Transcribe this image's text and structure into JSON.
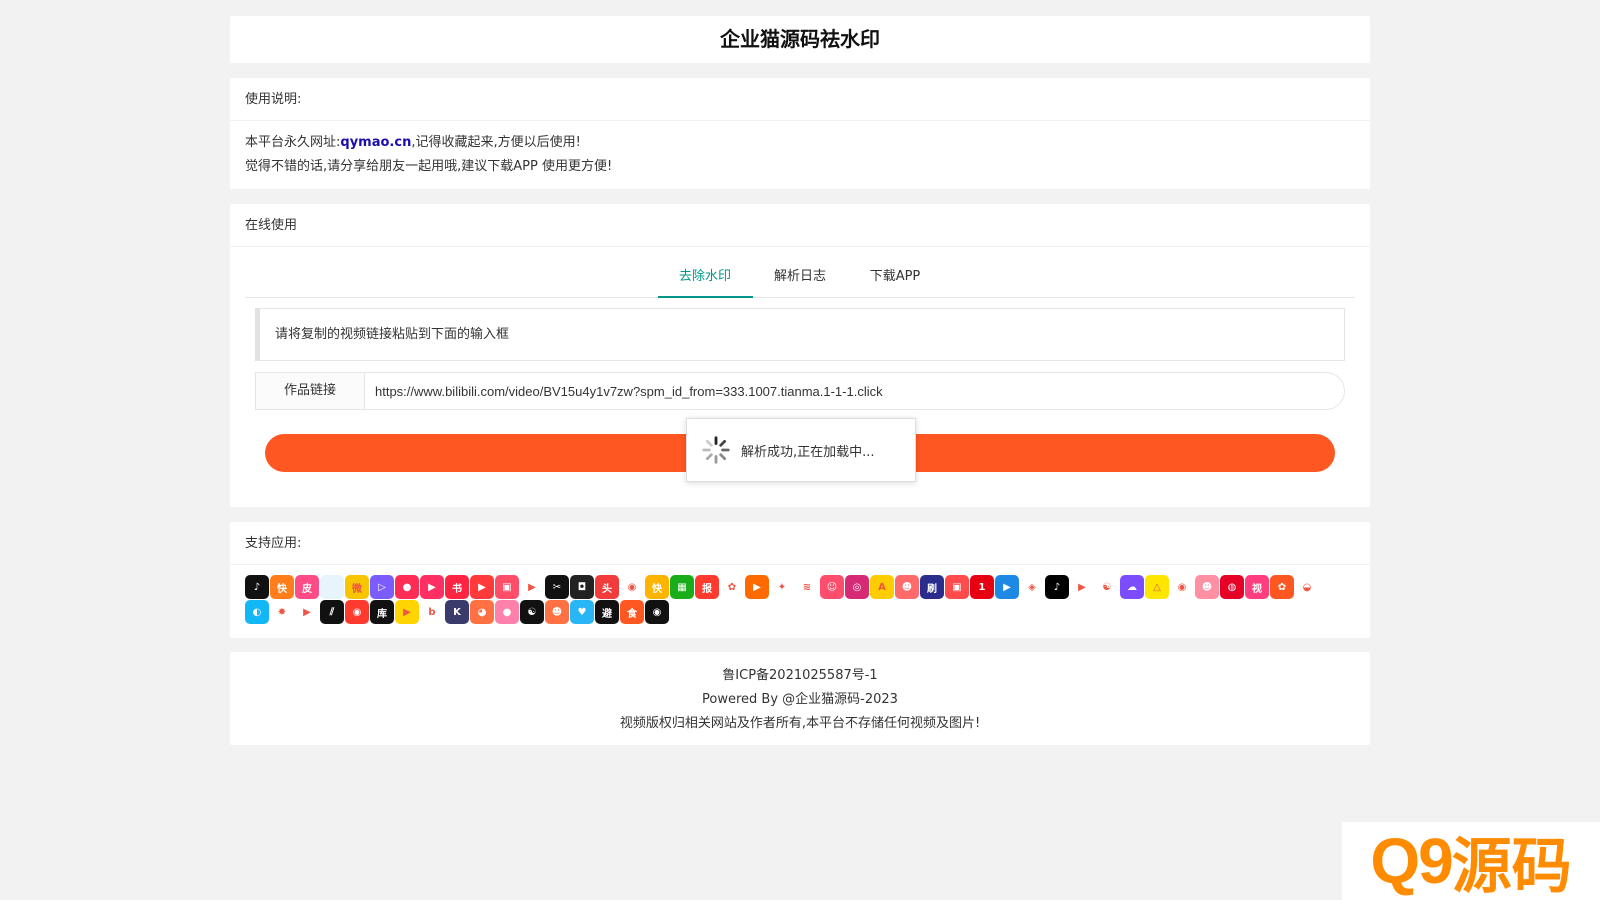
{
  "title": "企业猫源码祛水印",
  "usage": {
    "heading": "使用说明:",
    "line1_prefix": "本平台永久网址:",
    "line1_link": "qymao.cn",
    "line1_suffix": ",记得收藏起来,方便以后使用!",
    "line2": "觉得不错的话,请分享给朋友一起用哦,建议下载APP 使用更方便!"
  },
  "online": {
    "heading": "在线使用",
    "tabs": [
      "去除水印",
      "解析日志",
      "下载APP"
    ],
    "active_tab": 0,
    "tip": "请将复制的视频链接粘贴到下面的输入框",
    "field_label": "作品链接",
    "field_value": "https://www.bilibili.com/video/BV15u4y1v7zw?spm_id_from=333.1007.tianma.1-1-1.click",
    "loading_text": "解析成功,正在加载中..."
  },
  "apps": {
    "heading": "支持应用:",
    "icons": [
      {
        "name": "douyin-icon",
        "color": "#111111",
        "glyph": "♪"
      },
      {
        "name": "kuaishou-icon",
        "color": "#ff7e1b",
        "glyph": "快"
      },
      {
        "name": "pipixia-icon",
        "color": "#ff4b86",
        "glyph": "皮"
      },
      {
        "name": "bilibili-icon",
        "color": "#e8f4fb",
        "glyph": ""
      },
      {
        "name": "weibo-icon",
        "color": "#f7c600",
        "glyph": "微"
      },
      {
        "name": "vue-icon",
        "color": "#7b5cff",
        "glyph": "▷"
      },
      {
        "name": "pipigaoxiao-icon",
        "color": "#ff2d55",
        "glyph": "●"
      },
      {
        "name": "zuiyou-icon",
        "color": "#ff2e63",
        "glyph": "▶"
      },
      {
        "name": "xiaohongshu-icon",
        "color": "#ff2442",
        "glyph": "书"
      },
      {
        "name": "haokan-icon",
        "color": "#ff3a3a",
        "glyph": "▶"
      },
      {
        "name": "video-icon",
        "color": "#ff4e6a",
        "glyph": "▣"
      },
      {
        "name": "play-icon",
        "color": "#ffffff",
        "glyph": "▶"
      },
      {
        "name": "capcut-icon",
        "color": "#111111",
        "glyph": "✂"
      },
      {
        "name": "recorder-icon",
        "color": "#222222",
        "glyph": "◘"
      },
      {
        "name": "toutiao-icon",
        "color": "#f23c3c",
        "glyph": "头"
      },
      {
        "name": "lvzhou-icon",
        "color": "#ffffff",
        "glyph": "◉"
      },
      {
        "name": "kuai-icon",
        "color": "#ffb400",
        "glyph": "快"
      },
      {
        "name": "sheets-icon",
        "color": "#1aad19",
        "glyph": "▦"
      },
      {
        "name": "kuaibao-icon",
        "color": "#ff3b30",
        "glyph": "报"
      },
      {
        "name": "qie-icon",
        "color": "#ffffff",
        "glyph": "✿"
      },
      {
        "name": "xigua-icon",
        "color": "#ff6a00",
        "glyph": "▶"
      },
      {
        "name": "twitter-icon",
        "color": "#ffffff",
        "glyph": "✦"
      },
      {
        "name": "waves-icon",
        "color": "#ffffff",
        "glyph": "≋"
      },
      {
        "name": "momo-icon",
        "color": "#ff4d6d",
        "glyph": "☺"
      },
      {
        "name": "instagram-icon",
        "color": "#d62976",
        "glyph": "◎"
      },
      {
        "name": "acfun-icon",
        "color": "#ffcc00",
        "glyph": "A"
      },
      {
        "name": "avatar-app-icon",
        "color": "#ff6b6b",
        "glyph": "☻"
      },
      {
        "name": "shua-icon",
        "color": "#2b2d8c",
        "glyph": "刷"
      },
      {
        "name": "screen-icon",
        "color": "#ff4b4b",
        "glyph": "▣"
      },
      {
        "name": "yizhibo-icon",
        "color": "#e60012",
        "glyph": "1"
      },
      {
        "name": "youku-icon",
        "color": "#1e88e5",
        "glyph": "▶"
      },
      {
        "name": "iqiyi-icon",
        "color": "#ffffff",
        "glyph": "◈"
      },
      {
        "name": "tiktok-icon",
        "color": "#000000",
        "glyph": "♪"
      },
      {
        "name": "youtube-icon",
        "color": "#ffffff",
        "glyph": "▶"
      },
      {
        "name": "panda-icon",
        "color": "#ffffff",
        "glyph": "☯"
      },
      {
        "name": "chat-icon",
        "color": "#7c4dff",
        "glyph": "☁"
      },
      {
        "name": "yellow-app-icon",
        "color": "#ffe600",
        "glyph": "△"
      },
      {
        "name": "eye-icon",
        "color": "#ffffff",
        "glyph": "◉"
      },
      {
        "name": "face-icon",
        "color": "#ff8fa3",
        "glyph": "☻"
      },
      {
        "name": "netease-music-icon",
        "color": "#e60026",
        "glyph": "◍"
      },
      {
        "name": "shipin-icon",
        "color": "#ff3d7f",
        "glyph": "视"
      },
      {
        "name": "cartoon-icon",
        "color": "#ff5722",
        "glyph": "✿"
      },
      {
        "name": "bowl-icon",
        "color": "#ffffff",
        "glyph": "◒"
      },
      {
        "name": "qq-icon",
        "color": "#12b7f5",
        "glyph": "◐"
      },
      {
        "name": "squirrel-icon",
        "color": "#ffffff",
        "glyph": "✸"
      },
      {
        "name": "purple-play-icon",
        "color": "#ffffff",
        "glyph": "▶"
      },
      {
        "name": "stripes-icon",
        "color": "#111111",
        "glyph": "⫽"
      },
      {
        "name": "zhibo-icon",
        "color": "#ff3b30",
        "glyph": "◉"
      },
      {
        "name": "huaku-icon",
        "color": "#111111",
        "glyph": "库"
      },
      {
        "name": "yellow-play-icon",
        "color": "#ffd400",
        "glyph": "▶"
      },
      {
        "name": "b-icon",
        "color": "#ffffff",
        "glyph": "b"
      },
      {
        "name": "k-icon",
        "color": "#3b3b6b",
        "glyph": "K"
      },
      {
        "name": "colorful-icon",
        "color": "#ff7043",
        "glyph": "◕"
      },
      {
        "name": "bubble-icon",
        "color": "#ff80ab",
        "glyph": "●"
      },
      {
        "name": "panda-dark-icon",
        "color": "#111111",
        "glyph": "☯"
      },
      {
        "name": "monkey-icon",
        "color": "#ff7043",
        "glyph": "☻"
      },
      {
        "name": "heart-icon",
        "color": "#29b6f6",
        "glyph": "♥"
      },
      {
        "name": "bifeng-icon",
        "color": "#111111",
        "glyph": "避"
      },
      {
        "name": "food-icon",
        "color": "#ff5722",
        "glyph": "食"
      },
      {
        "name": "circle-icon",
        "color": "#111111",
        "glyph": "◉"
      }
    ]
  },
  "footer": {
    "icp": "鲁ICP备2021025587号-1",
    "powered": "Powered By @企业猫源码-2023",
    "notice": "视频版权归相关网站及作者所有,本平台不存储任何视频及图片!"
  },
  "watermark": {
    "prefix": "Q9",
    "suffix": "源码"
  }
}
